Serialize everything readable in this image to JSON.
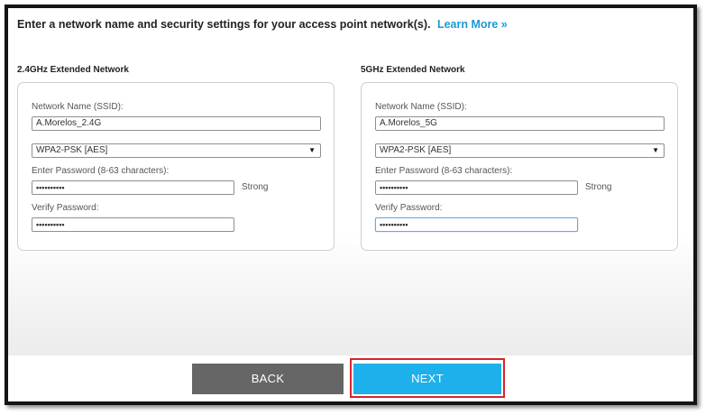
{
  "intro": {
    "text": "Enter a network name and security settings for your access point network(s).",
    "learn_more": "Learn More »"
  },
  "networks": [
    {
      "title": "2.4GHz Extended Network",
      "ssid_label": "Network Name (SSID):",
      "ssid_value": "A.Morelos_2.4G",
      "security_value": "WPA2-PSK [AES]",
      "password_label": "Enter Password (8-63 characters):",
      "password_value": "••••••••••",
      "strength": "Strong",
      "verify_label": "Verify Password:",
      "verify_value": "••••••••••"
    },
    {
      "title": "5GHz Extended Network",
      "ssid_label": "Network Name (SSID):",
      "ssid_value": "A.Morelos_5G",
      "security_value": "WPA2-PSK [AES]",
      "password_label": "Enter Password (8-63 characters):",
      "password_value": "••••••••••",
      "strength": "Strong",
      "verify_label": "Verify Password:",
      "verify_value": "••••••••••"
    }
  ],
  "buttons": {
    "back": "BACK",
    "next": "NEXT"
  },
  "icons": {
    "dropdown": "chevron-down-icon"
  },
  "colors": {
    "link": "#1a9ad6",
    "next_button": "#1db0ea",
    "back_button": "#666666",
    "highlight_outline": "#d9232d"
  }
}
